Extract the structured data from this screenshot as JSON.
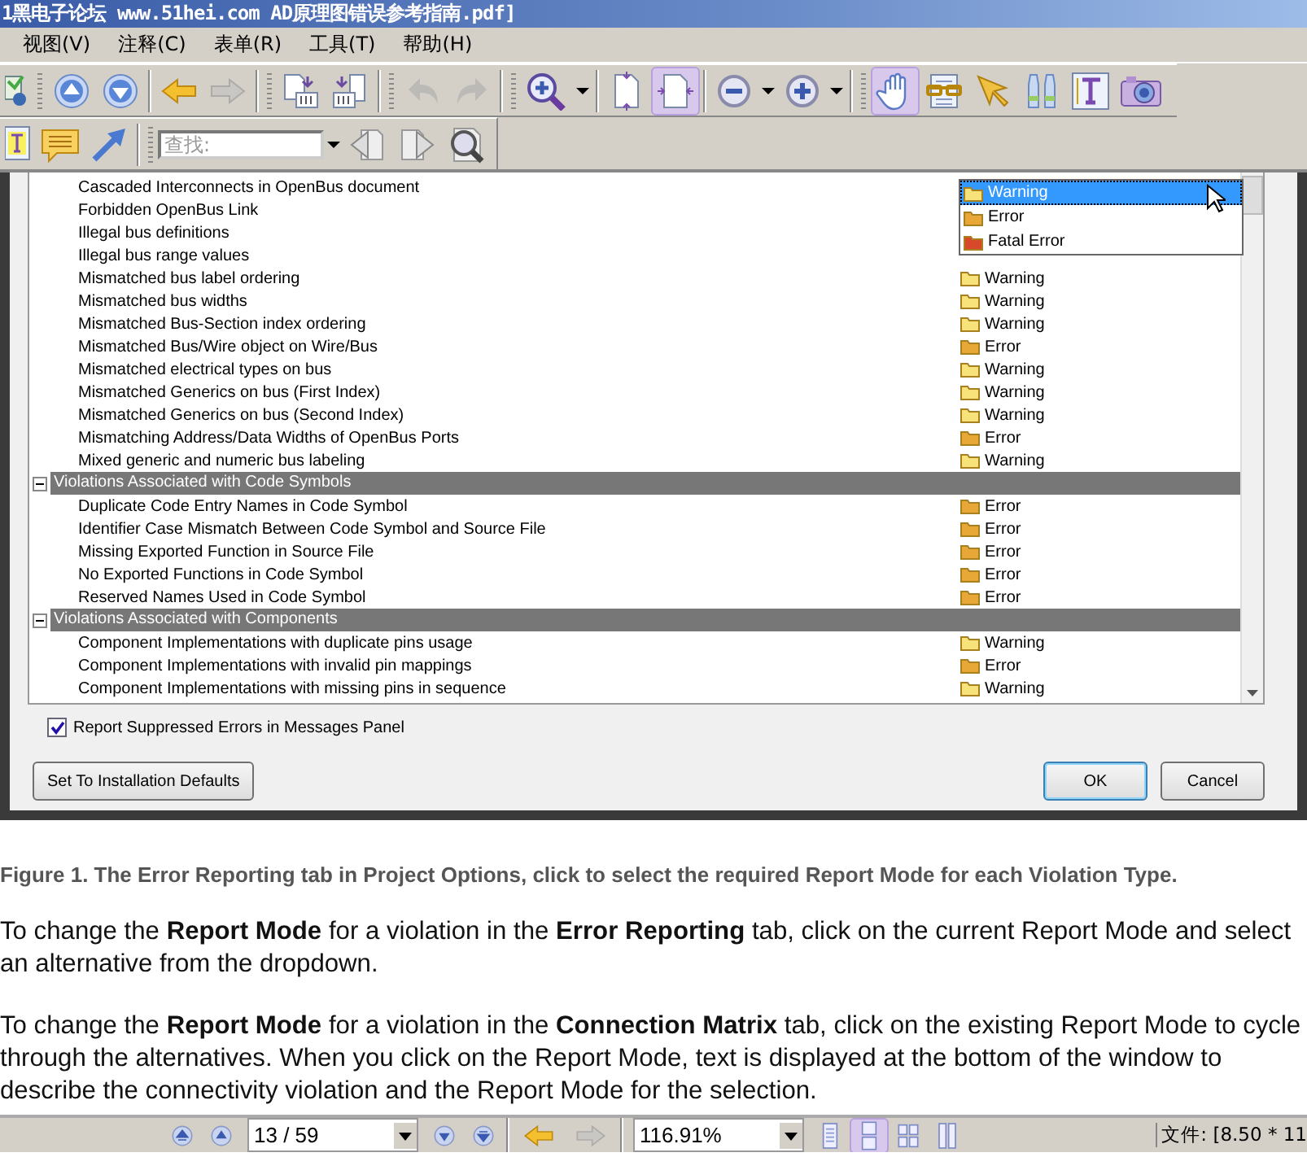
{
  "window": {
    "title": "1黑电子论坛 www.51hei.com AD原理图错误参考指南.pdf]"
  },
  "menu": [
    {
      "label": "视图(V)"
    },
    {
      "label": "注释(C)"
    },
    {
      "label": "表单(R)"
    },
    {
      "label": "工具(T)"
    },
    {
      "label": "帮助(H)"
    }
  ],
  "toolbars": [
    {
      "items": [
        {
          "kind": "stamp"
        },
        {
          "kind": "grip"
        },
        {
          "kind": "page-up"
        },
        {
          "kind": "page-down"
        },
        {
          "kind": "sep"
        },
        {
          "kind": "back"
        },
        {
          "kind": "forward",
          "disabled": true
        },
        {
          "kind": "sep"
        },
        {
          "kind": "grip"
        },
        {
          "kind": "extract"
        },
        {
          "kind": "insert"
        },
        {
          "kind": "sep"
        },
        {
          "kind": "grip"
        },
        {
          "kind": "undo",
          "disabled": true
        },
        {
          "kind": "redo",
          "disabled": true
        },
        {
          "kind": "sep"
        },
        {
          "kind": "grip"
        },
        {
          "kind": "zoom-tool"
        },
        {
          "kind": "caret"
        },
        {
          "kind": "sep"
        },
        {
          "kind": "fit-page"
        },
        {
          "kind": "fit-width",
          "active": true
        },
        {
          "kind": "sep"
        },
        {
          "kind": "zoom-out"
        },
        {
          "kind": "caret"
        },
        {
          "kind": "zoom-in"
        },
        {
          "kind": "caret"
        },
        {
          "kind": "sep"
        },
        {
          "kind": "grip"
        },
        {
          "kind": "hand",
          "active": true
        },
        {
          "kind": "reader"
        },
        {
          "kind": "pointer"
        },
        {
          "kind": "binoculars"
        },
        {
          "kind": "text-select"
        },
        {
          "kind": "camera"
        }
      ]
    },
    {
      "items": [
        {
          "kind": "note-text"
        },
        {
          "kind": "comment"
        },
        {
          "kind": "arrow"
        },
        {
          "kind": "sep"
        },
        {
          "kind": "grip"
        },
        {
          "kind": "search",
          "placeholder": "查找:"
        },
        {
          "kind": "caret"
        },
        {
          "kind": "prev-result"
        },
        {
          "kind": "next-result"
        },
        {
          "kind": "search-doc"
        }
      ]
    }
  ],
  "dialog": {
    "rows": [
      {
        "kind": "item",
        "name": "Cascaded Interconnects in OpenBus document"
      },
      {
        "kind": "item",
        "name": "Forbidden OpenBus Link"
      },
      {
        "kind": "item",
        "name": "Illegal bus definitions"
      },
      {
        "kind": "item",
        "name": "Illegal bus range values"
      },
      {
        "kind": "item",
        "name": "Mismatched bus label ordering",
        "mode": "Warning",
        "color": "#f8e27a"
      },
      {
        "kind": "item",
        "name": "Mismatched bus widths",
        "mode": "Warning",
        "color": "#f8e27a"
      },
      {
        "kind": "item",
        "name": "Mismatched Bus-Section index ordering",
        "mode": "Warning",
        "color": "#f8e27a"
      },
      {
        "kind": "item",
        "name": "Mismatched Bus/Wire object on Wire/Bus",
        "mode": "Error",
        "color": "#e8a838"
      },
      {
        "kind": "item",
        "name": "Mismatched electrical types on bus",
        "mode": "Warning",
        "color": "#f8e27a"
      },
      {
        "kind": "item",
        "name": "Mismatched Generics on bus (First Index)",
        "mode": "Warning",
        "color": "#f8e27a"
      },
      {
        "kind": "item",
        "name": "Mismatched Generics on bus (Second Index)",
        "mode": "Warning",
        "color": "#f8e27a"
      },
      {
        "kind": "item",
        "name": "Mismatching Address/Data Widths of OpenBus Ports",
        "mode": "Error",
        "color": "#e8a838"
      },
      {
        "kind": "item",
        "name": "Mixed generic and numeric bus labeling",
        "mode": "Warning",
        "color": "#f8e27a"
      },
      {
        "kind": "group",
        "title": "Violations Associated with Code Symbols",
        "expanded": true,
        "children": [
          {
            "kind": "item",
            "name": "Duplicate Code Entry Names in Code Symbol",
            "mode": "Error",
            "color": "#e8a838"
          },
          {
            "kind": "item",
            "name": "Identifier Case Mismatch Between Code Symbol and Source File",
            "mode": "Error",
            "color": "#e8a838"
          },
          {
            "kind": "item",
            "name": "Missing Exported Function in Source File",
            "mode": "Error",
            "color": "#e8a838"
          },
          {
            "kind": "item",
            "name": "No Exported Functions in Code Symbol",
            "mode": "Error",
            "color": "#e8a838"
          },
          {
            "kind": "item",
            "name": "Reserved Names Used in Code Symbol",
            "mode": "Error",
            "color": "#e8a838"
          }
        ]
      },
      {
        "kind": "group",
        "title": "Violations Associated with Components",
        "expanded": true,
        "children": [
          {
            "kind": "item",
            "name": "Component Implementations with duplicate pins usage",
            "mode": "Warning",
            "color": "#f8e27a"
          },
          {
            "kind": "item",
            "name": "Component Implementations with invalid pin mappings",
            "mode": "Error",
            "color": "#e8a838"
          },
          {
            "kind": "item",
            "name": "Component Implementations with missing pins in sequence",
            "mode": "Warning",
            "color": "#f8e27a"
          }
        ]
      }
    ],
    "dropdown": {
      "options": [
        {
          "label": "Warning",
          "color": "#f8e27a",
          "selected": true
        },
        {
          "label": "Error",
          "color": "#e8a838",
          "selected": false
        },
        {
          "label": "Fatal Error",
          "color": "#d8482a",
          "selected": false
        }
      ]
    },
    "checkbox": {
      "label": "Report Suppressed Errors in Messages Panel",
      "checked": true
    },
    "buttons": [
      {
        "label": "Set To Installation Defaults",
        "default": false,
        "kind": "left"
      },
      {
        "label": "OK",
        "default": true,
        "kind": "right"
      },
      {
        "label": "Cancel",
        "default": false,
        "kind": "right"
      }
    ]
  },
  "caption": "Figure 1. The Error Reporting tab in Project Options, click to select the required Report Mode for each Violation Type.",
  "paragraphs": [
    "To change the **Report Mode** for a violation in the **Error Reporting** tab, click on the current Report Mode and select an alternative from the dropdown.",
    "To change the **Report Mode** for a violation in the **Connection Matrix** tab, click on the existing Report Mode to cycle through the alternatives. When you click on the Report Mode, text is displayed at the bottom of the window to describe the connectivity violation and the Report Mode for the selection."
  ],
  "status_bar": {
    "items": [
      {
        "kind": "first-page"
      },
      {
        "kind": "prev-page"
      },
      {
        "kind": "field",
        "value": "13 / 59"
      },
      {
        "kind": "next-page"
      },
      {
        "kind": "last-page"
      },
      {
        "kind": "sep"
      },
      {
        "kind": "back"
      },
      {
        "kind": "forward",
        "disabled": true
      },
      {
        "kind": "sep"
      },
      {
        "kind": "field",
        "value": "116.91%"
      },
      {
        "kind": "single"
      },
      {
        "kind": "continuous",
        "active": true
      },
      {
        "kind": "facing"
      },
      {
        "kind": "cont-facing"
      }
    ],
    "info": "文件: [8.50 * 11"
  }
}
